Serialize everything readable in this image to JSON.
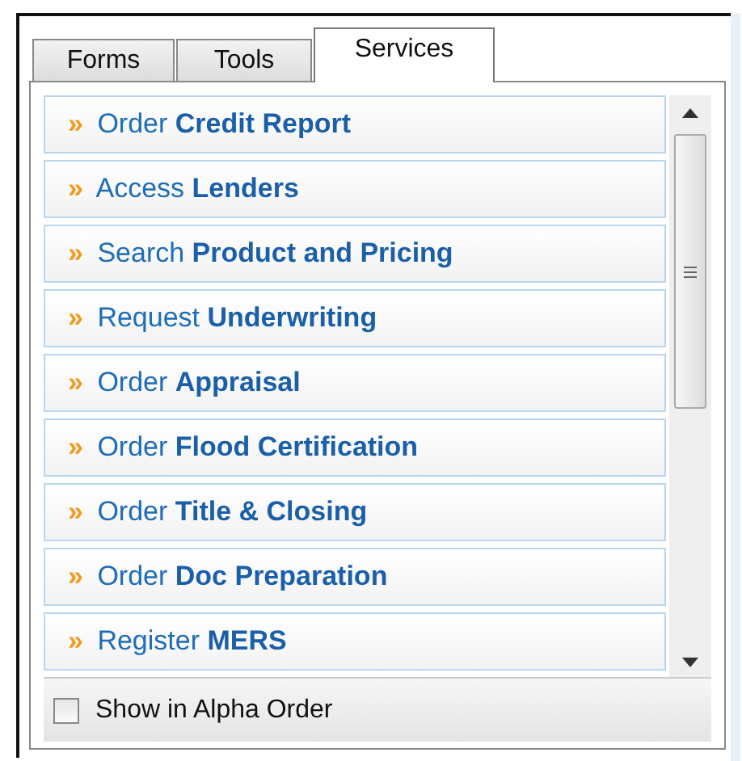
{
  "tabs": [
    {
      "label": "Forms",
      "selected": false
    },
    {
      "label": "Tools",
      "selected": false
    },
    {
      "label": "Services",
      "selected": true
    }
  ],
  "services": [
    {
      "marker": "»",
      "text": "Order **Credit Report**"
    },
    {
      "marker": "»",
      "text": "Access **Lenders**"
    },
    {
      "marker": "»",
      "text": "Search **Product and Pricing**"
    },
    {
      "marker": "»",
      "text": "Request **Underwriting**"
    },
    {
      "marker": "»",
      "text": "Order **Appraisal**"
    },
    {
      "marker": "»",
      "text": "Order **Flood Certification**"
    },
    {
      "marker": "»",
      "text": "Order **Title & Closing**"
    },
    {
      "marker": "»",
      "text": "Order **Doc Preparation**"
    },
    {
      "marker": "»",
      "text": "Register **MERS**"
    }
  ],
  "alpha_order": {
    "label": "Show in Alpha Order",
    "checked": false
  }
}
